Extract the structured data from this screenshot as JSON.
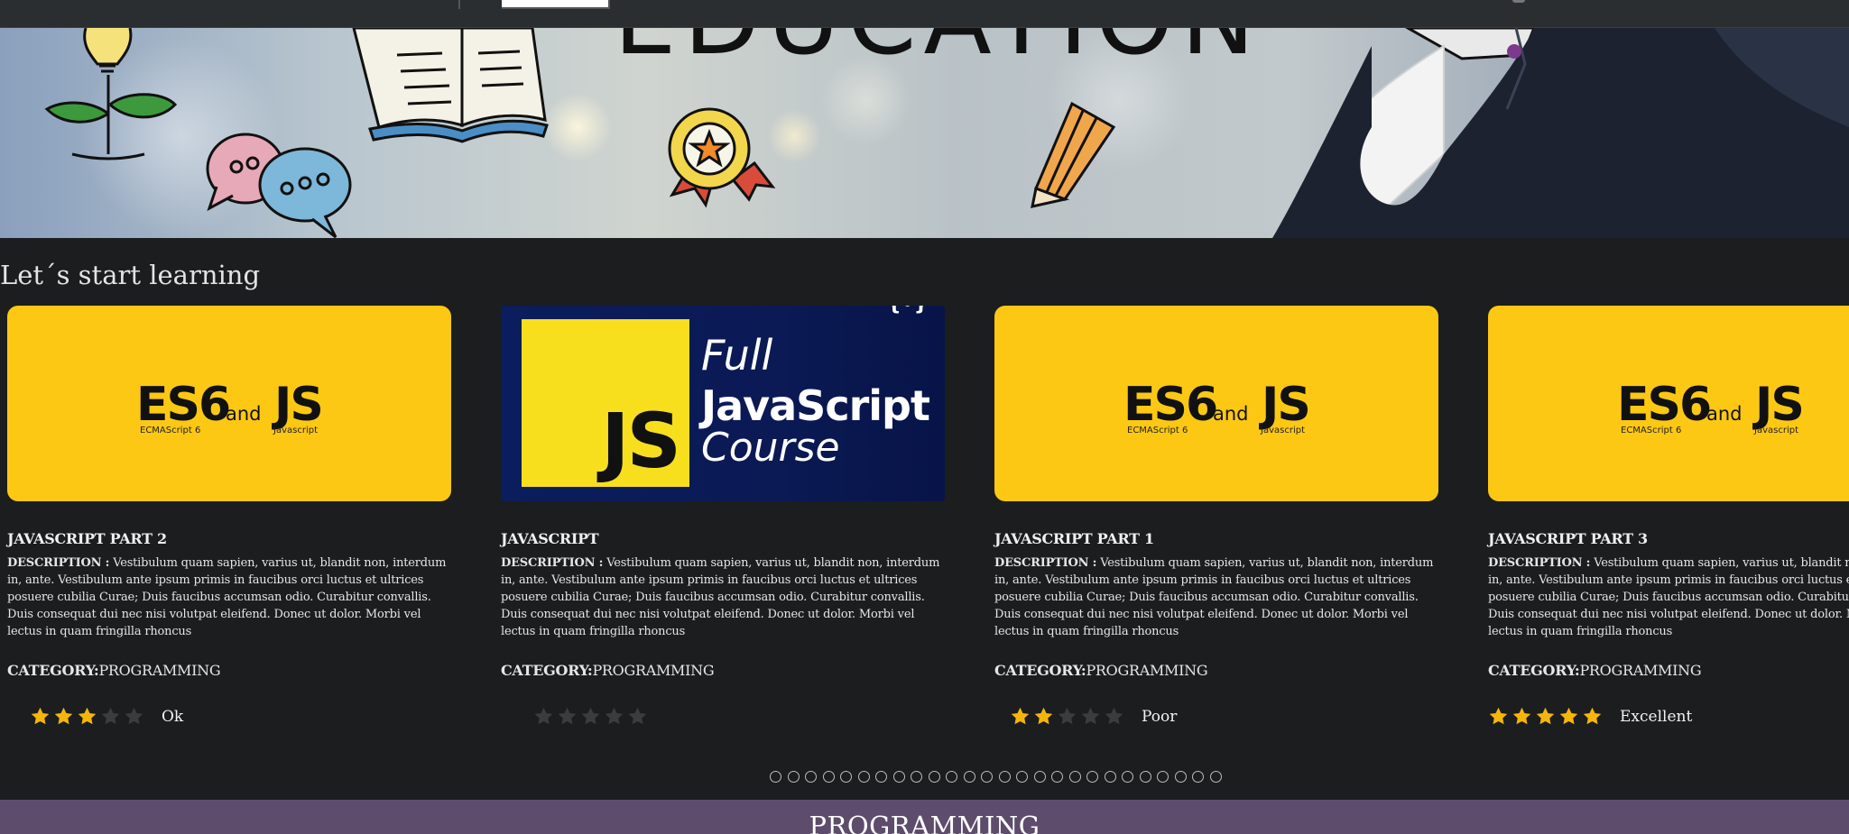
{
  "section_title": "Let´s start learning",
  "hero": {
    "heading_text": "EDUCATION"
  },
  "courses": [
    {
      "title": "JAVASCRIPT PART 2",
      "thumb": "es6",
      "desc_label": "DESCRIPTION :",
      "description": "Vestibulum quam sapien, varius ut, blandit non, interdum in, ante. Vestibulum ante ipsum primis in faucibus orci luctus et ultrices posuere cubilia Curae; Duis faucibus accumsan odio. Curabitur convallis. Duis consequat dui nec nisi volutpat eleifend. Donec ut dolor. Morbi vel lectus in quam fringilla rhoncus",
      "cat_label": "CATEGORY:",
      "category": "PROGRAMMING",
      "rating": 3,
      "rating_label": "Ok"
    },
    {
      "title": "JAVASCRIPT",
      "thumb": "fulljs",
      "desc_label": "DESCRIPTION :",
      "description": "Vestibulum quam sapien, varius ut, blandit non, interdum in, ante. Vestibulum ante ipsum primis in faucibus orci luctus et ultrices posuere cubilia Curae; Duis faucibus accumsan odio. Curabitur convallis. Duis consequat dui nec nisi volutpat eleifend. Donec ut dolor. Morbi vel lectus in quam fringilla rhoncus",
      "cat_label": "CATEGORY:",
      "category": "PROGRAMMING",
      "rating": 0,
      "rating_label": ""
    },
    {
      "title": "JAVASCRIPT PART 1",
      "thumb": "es6",
      "desc_label": "DESCRIPTION :",
      "description": "Vestibulum quam sapien, varius ut, blandit non, interdum in, ante. Vestibulum ante ipsum primis in faucibus orci luctus et ultrices posuere cubilia Curae; Duis faucibus accumsan odio. Curabitur convallis. Duis consequat dui nec nisi volutpat eleifend. Donec ut dolor. Morbi vel lectus in quam fringilla rhoncus",
      "cat_label": "CATEGORY:",
      "category": "PROGRAMMING",
      "rating": 2,
      "rating_label": "Poor"
    },
    {
      "title": "JAVASCRIPT PART 3",
      "thumb": "es6",
      "desc_label": "DESCRIPTION :",
      "description": "Vestibulum quam sapien, varius ut, blandit non, interdum in, ante. Vestibulum ante ipsum primis in faucibus orci luctus et ultrices posuere cubilia Curae; Duis faucibus accumsan odio. Curabitur convallis. Duis consequat dui nec nisi volutpat eleifend. Donec ut dolor. Morbi vel lectus in quam fringilla rhoncus",
      "cat_label": "CATEGORY:",
      "category": "PROGRAMMING",
      "rating": 5,
      "rating_label": "Excellent"
    }
  ],
  "es6_logo": {
    "es6": "ES6",
    "and": "and",
    "js": "JS",
    "es6_sub": "ECMAScript 6",
    "js_sub": "Javascript"
  },
  "fulljs_logo": {
    "js": "JS",
    "line1": "Full",
    "line2": "JavaScript",
    "line3": "Course",
    "mark": "{•}"
  },
  "carousel": {
    "dot_count": 26
  },
  "category_bar": {
    "label": "PROGRAMMING"
  },
  "colors": {
    "star_on": "#f5b50a",
    "star_off": "#3a3c3e",
    "card_yellow": "#fcc813",
    "category_bar": "#5e4c6c"
  }
}
